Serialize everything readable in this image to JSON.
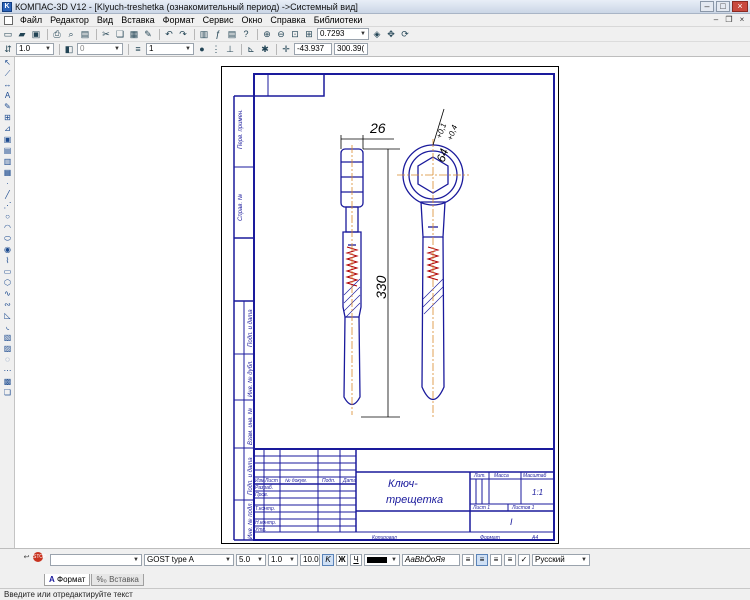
{
  "window": {
    "title": "КОМПАС-3D V12 - [Klyuch-treshetka (ознакомительный период) ->Системный вид]",
    "icon": "kompas-app-icon"
  },
  "menu": [
    "Файл",
    "Редактор",
    "Вид",
    "Вставка",
    "Формат",
    "Сервис",
    "Окно",
    "Справка",
    "Библиотеки"
  ],
  "toolbar": {
    "zoom": "0.7293",
    "coord_x": "-43.937",
    "coord_y": "300.39("
  },
  "props": {
    "step": "1.0",
    "style_value": "0",
    "layer": "1"
  },
  "drawing": {
    "dim_width": "26",
    "dim_length": "330",
    "dim_hole": "64",
    "tol_upper": "+0,4",
    "tol_lower": "+0,1",
    "title_line1": "Ключ-",
    "title_line2": "трещетка",
    "col_lit": "Лит.",
    "col_mass": "Масса",
    "col_scale": "Масштаб",
    "scale_value": "1:1",
    "sheet_label": "Лист 1",
    "sheets_label": "Листов 1",
    "copied": "Копировал",
    "format": "Формат",
    "format_value": "A4",
    "row_izm": "Изм",
    "row_list": "Лист",
    "row_doc": "№ докум.",
    "row_sign": "Подп.",
    "row_date": "Дата",
    "row_razrab": "Разраб.",
    "row_prov": "Пров.",
    "row_tkontr": "Т.контр.",
    "row_nkontr": "Н.контр.",
    "row_utv": "Утв.",
    "side": [
      "Перв. примен.",
      "Справ. №",
      "Подп. и дата",
      "Инв. № дубл.",
      "Взам. инв. №",
      "Подп. и дата",
      "Инв. № подл."
    ]
  },
  "textpanel": {
    "font": "GOST type A",
    "height": "5.0",
    "ratio": "1.0",
    "scale": "10.0",
    "sample": "АаВbÖоЯя",
    "language": "Русский"
  },
  "tabs": [
    "Формат",
    "Вставка"
  ],
  "status": "Введите или отредактируйте текст",
  "colors": {
    "drawing": "#1a1a9c",
    "centerline": "#d98a2b",
    "spring": "#b00000"
  }
}
